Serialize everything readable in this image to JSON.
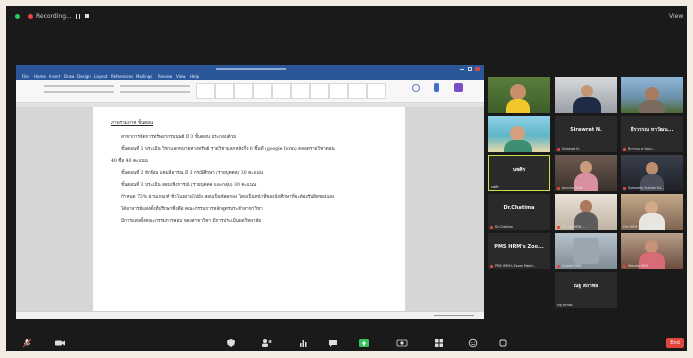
{
  "topbar": {
    "recording_label": "Recording...",
    "view_label": "View"
  },
  "word": {
    "menu": [
      "File",
      "Home",
      "Insert",
      "Draw",
      "Design",
      "Layout",
      "References",
      "Mailings",
      "Review",
      "View",
      "Help"
    ],
    "document_lines": [
      "ภาพรวมภาค ขั้นตอน",
      "สาขาการจัดการทรัพยากรมนุษย์ มี 3 ขั้นตอน ประกอบด้วย",
      "ขั้นตอนที่ 1 ประเมิน วิชาแลกหมายทางทรัพย์ รายวิชาแลกหลังกึ่ง 6 ชิ้นที่ (google form) ตลอดรายวิชาตอน",
      "40 ชื่อ 40 คะแนน",
      "ขั้นตอนที่ 2 ทักษิณ แคมลีอารณ มี 3 กรณีศึกษา (รายบุคคล) 30 คะแนน",
      "ขั้นตอนที่ 3 ประเมิน สอบเชิงการณ์ (รายบุคคล และกลุ่ม) 30 คะแนน",
      "กำหนด 75% ผ่านเกณฑ์ ชั่วโมงผ่านไปยัง สอบเป็นข้อตกลง โดยเป็นหน้าที่ของนักศึกษาที่จะต้องรับผิดชอบเอง",
      "ได้อาจารย์แต่งตั้งที่ปรึกษาซึ่งคือ คณะกรรมการหลักสูตรประจำสาขาวิชา",
      "มีการแต่งตั้งคณะกรรมการสอบ ของสาขาวิชา มีการประเมินผลวิทยาลัย"
    ]
  },
  "participants": [
    {
      "name": "",
      "caption": "",
      "type": "video"
    },
    {
      "name": "",
      "caption": "",
      "type": "video"
    },
    {
      "name": "",
      "caption": "",
      "type": "video"
    },
    {
      "name": "",
      "caption": "",
      "type": "video"
    },
    {
      "name": "Sirawrat N.",
      "caption": "Sirawrat N.",
      "type": "name"
    },
    {
      "name": "ธีรวรรณ ทาวัฒน...",
      "caption": "ธีรวรรณ ทาวัฒน...",
      "type": "name"
    },
    {
      "name": "นพศิร",
      "caption": "นพศิร",
      "type": "name"
    },
    {
      "name": "",
      "caption": "Anucha HRM",
      "type": "video"
    },
    {
      "name": "",
      "caption": "Sumontip Sukkae 64...",
      "type": "video"
    },
    {
      "name": "Dr.Chatima",
      "caption": "Dr.Chatima",
      "type": "name"
    },
    {
      "name": "",
      "caption": "Dr.Urai HRM ...",
      "type": "video"
    },
    {
      "name": "",
      "caption": "Pim HRM SAI...",
      "type": "video"
    },
    {
      "name": "PMS HRM's Zoo...",
      "caption": "PMS HRM's Zoom Meeti...",
      "type": "name"
    },
    {
      "name": "",
      "caption": "Suwatt HRM",
      "type": "video"
    },
    {
      "name": "",
      "caption": "Wanida HRM",
      "type": "video"
    },
    {
      "name": "ณฐ สถาพล",
      "caption": "ณฐ สถาพล",
      "type": "name"
    }
  ],
  "bottombar": {
    "end_label": "End"
  }
}
